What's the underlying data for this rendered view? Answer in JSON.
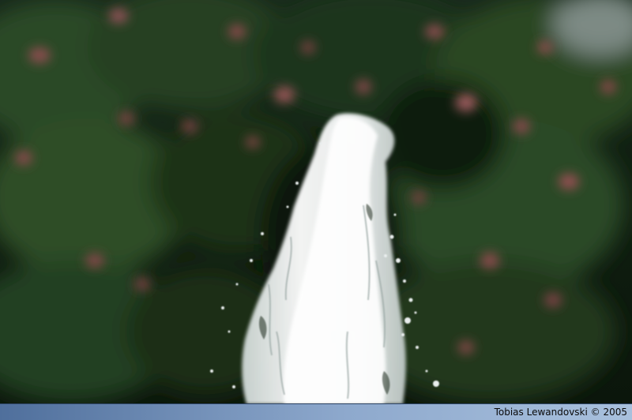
{
  "photo": {
    "subject": "water-fountain-jet",
    "colors": {
      "foliage_dark": "#0d1a0d",
      "foliage_mid": "#23401f",
      "blossom": "#a8575a",
      "water": "#f4f7f8",
      "caption_bar": "#8ea9cd"
    }
  },
  "caption": {
    "credit": "Tobias Lewandovski © 2005"
  }
}
